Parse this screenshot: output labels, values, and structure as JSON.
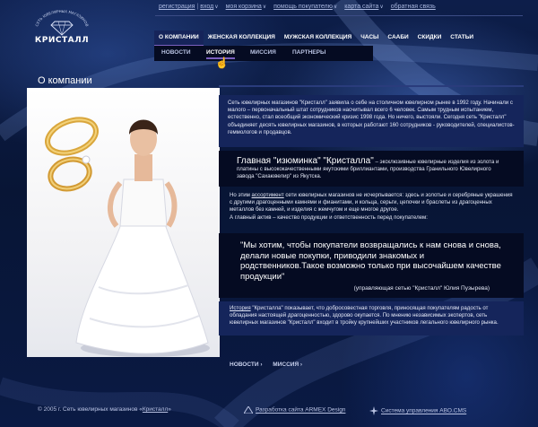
{
  "logo": {
    "arc_text": "СЕТЬ ЮВЕЛИРНЫХ МАГАЗИНОВ",
    "name": "КРИСТАЛЛ"
  },
  "top_nav": {
    "items": [
      "регистрация",
      "вход",
      "моя корзина",
      "помощь покупателю",
      "карта сайта",
      "обратная связь"
    ],
    "separator": "|",
    "chevron": "∨"
  },
  "main_nav": {
    "items": [
      "О КОМПАНИИ",
      "ЖЕНСКАЯ КОЛЛЕКЦИЯ",
      "МУЖСКАЯ КОЛЛЕКЦИЯ",
      "ЧАСЫ",
      "СААБИ",
      "СКИДКИ",
      "СТАТЬИ"
    ],
    "active_index": 0
  },
  "sub_nav": {
    "items": [
      "НОВОСТИ",
      "ИСТОРИЯ",
      "МИССИЯ",
      "ПАРТНЕРЫ"
    ],
    "active_index": 1
  },
  "page_title": "О компании",
  "content": {
    "intro": "Сеть ювелирных магазинов \"Кристалл\" заявила о себе на столичном ювелирном рынке в 1992 году. Начинали с малого – первоначальный штат сотрудников насчитывал всего 6 человек. Самым трудным испытанием, естественно, стал всеобщий экономический кризис 1998 года. Но ничего, выстояли. Сегодня сеть \"Кристалл\" объединяет десять ювелирных магазинов, в которых работают 160 сотрудников - руководителей, специалистов-геммологов и продавцов.",
    "highlight_title": "Главная \"изюминка\" \"Кристалла\"",
    "highlight_rest": " – эксклюзивные ювелирные изделия из золота и платины с высококачественными якутскими бриллиантами, производства Гранильного Ювелирного завода \"Сахаювелир\" из Якутска.",
    "assortment_before": "Но этим ",
    "assortment_link": "ассортимент",
    "assortment_after": " сети ювелирных магазинов не исчерпывается: здесь и золотые и серебряные украшения с другими драгоценными камнями и фианитами, и кольца, серьги, цепочки и браслеты из драгоценных металлов без камней, и изделия с жемчугом и еще многое другое.",
    "assortment_last": "А главный актив – качество продукции и ответственность перед покупателем:",
    "quote": "\"Мы хотим, чтобы покупатели возвращались к нам снова и снова, делали новые покупки, приводили знакомых и родственников.Такое возможно только при высочайшем качестве продукции\"",
    "quote_sig": "(управляющая сетью \"Кристалл\" Юлия Пузырева)",
    "history_link": "История",
    "history_text": " \"Кристалла\" показывает, что добросовестная торговля, приносящая покупателям радость от обладания настоящей драгоценностью, здорово окупается. По мнению независимых экспертов, сеть ювелирных магазинов \"Кристалл\" входит в тройку крупнейших участников легального ювелирного рынка."
  },
  "bottom_links": [
    "НОВОСТИ ›",
    "МИССИЯ ›"
  ],
  "footer": {
    "copyright_prefix": "© 2005 г. Сеть ювелирных магазинов «",
    "copyright_link": "Кристалл",
    "copyright_suffix": "»",
    "dev": "Разработка сайта ARMEX Design",
    "cms": "Система управления ABO.CMS"
  },
  "colors": {
    "background": "#0a1636",
    "panel_light": "#15255b",
    "panel_dark": "#050b22",
    "accent": "#7a5fbf"
  }
}
